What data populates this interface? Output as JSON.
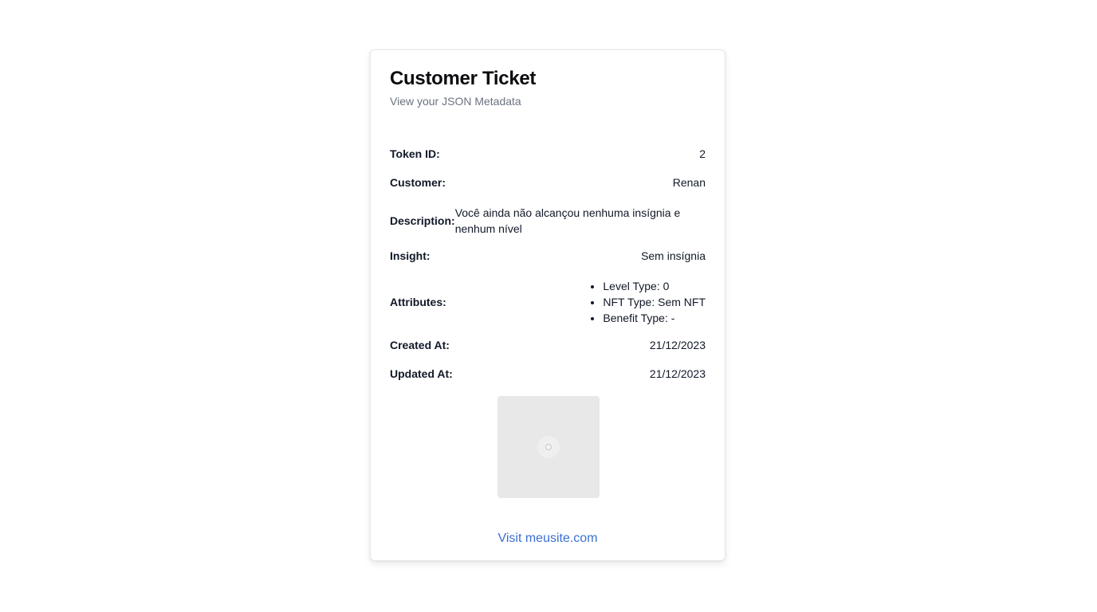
{
  "card": {
    "title": "Customer Ticket",
    "subtitle": "View your JSON Metadata"
  },
  "fields": {
    "token_id": {
      "label": "Token ID:",
      "value": "2"
    },
    "customer": {
      "label": "Customer:",
      "value": "Renan"
    },
    "description": {
      "label": "Description:",
      "value": "Você ainda não alcançou nenhuma insígnia e nenhum nível"
    },
    "insight": {
      "label": "Insight:",
      "value": "Sem insígnia"
    },
    "attributes": {
      "label": "Attributes:",
      "items": [
        "Level Type: 0",
        "NFT Type: Sem NFT",
        "Benefit Type: -"
      ]
    },
    "created_at": {
      "label": "Created At:",
      "value": "21/12/2023"
    },
    "updated_at": {
      "label": "Updated At:",
      "value": "21/12/2023"
    }
  },
  "image": {
    "icon": "image-placeholder-icon"
  },
  "footer": {
    "link_text": "Visit meusite.com"
  },
  "colors": {
    "link": "#3b6fd3",
    "muted": "#6b7280",
    "placeholder_bg": "#e8e8e8"
  }
}
